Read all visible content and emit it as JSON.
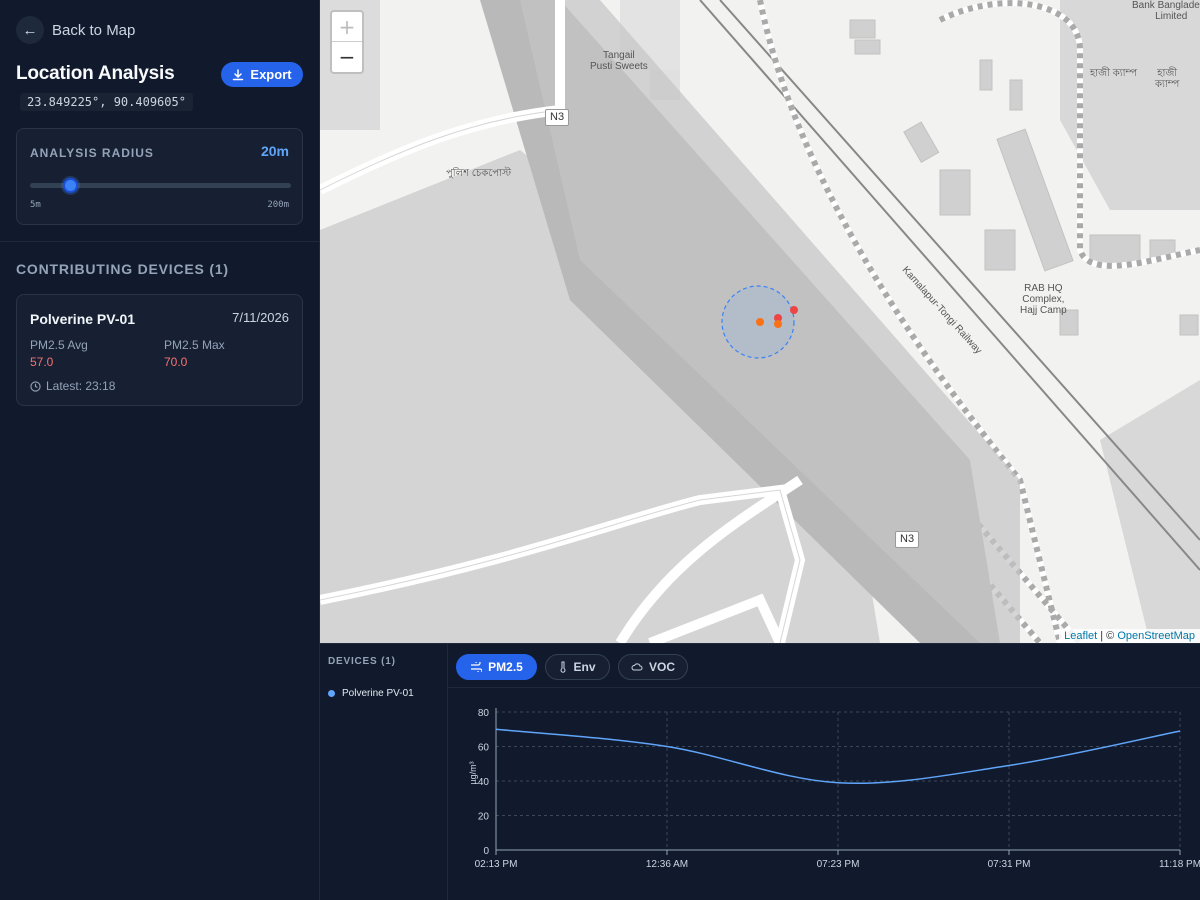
{
  "sidebar": {
    "back_label": "Back to Map",
    "title": "Location Analysis",
    "export_label": "Export",
    "coordinates": "23.849225°, 90.409605°",
    "radius": {
      "label": "ANALYSIS RADIUS",
      "value": "20m",
      "min_label": "5m",
      "max_label": "200m",
      "current": 20,
      "min": 5,
      "max": 200
    },
    "section_title": "CONTRIBUTING DEVICES (1)",
    "device": {
      "name": "Polverine PV-01",
      "date": "7/11/2026",
      "avg_label": "PM2.5 Avg",
      "avg_value": "57.0",
      "max_label": "PM2.5 Max",
      "max_value": "70.0",
      "latest": "Latest: 23:18"
    }
  },
  "map": {
    "zoom_in": "+",
    "zoom_out": "−",
    "attribution_leaflet": "Leaflet",
    "attribution_sep": " | © ",
    "attribution_osm": "OpenStreetMap",
    "labels": {
      "tangail": "Tangail\nPusti Sweets",
      "bank": "Bank Bangladesh\nLimited",
      "haji": "হাজী ক্যাম্প",
      "haji2": "হাজী\nক্যাম্প",
      "rab": "RAB HQ\nComplex,\nHajj Camp",
      "police": "পুলিশ চেকপোস্ট",
      "railway": "Kamalapur-Tongi Railway",
      "n3a": "N3",
      "n3b": "N3"
    }
  },
  "bottom": {
    "devices_title": "DEVICES (1)",
    "device_name": "Polverine PV-01",
    "tabs": [
      {
        "label": "PM2.5",
        "icon": "wind-icon"
      },
      {
        "label": "Env",
        "icon": "thermometer-icon"
      },
      {
        "label": "VOC",
        "icon": "cloud-icon"
      }
    ]
  },
  "colors": {
    "accent": "#2563eb",
    "line": "#60a5fa",
    "danger": "#f87171"
  },
  "chart_data": {
    "type": "line",
    "x": [
      "02:13 PM",
      "12:36 AM",
      "07:23 PM",
      "07:31 PM",
      "11:18 PM"
    ],
    "series": [
      {
        "name": "Polverine PV-01",
        "values": [
          70,
          60,
          39,
          49,
          69
        ]
      }
    ],
    "ylabel": "µg/m³",
    "ylim": [
      0,
      80
    ],
    "yticks": [
      0,
      20,
      40,
      60,
      80
    ],
    "grid": true
  }
}
